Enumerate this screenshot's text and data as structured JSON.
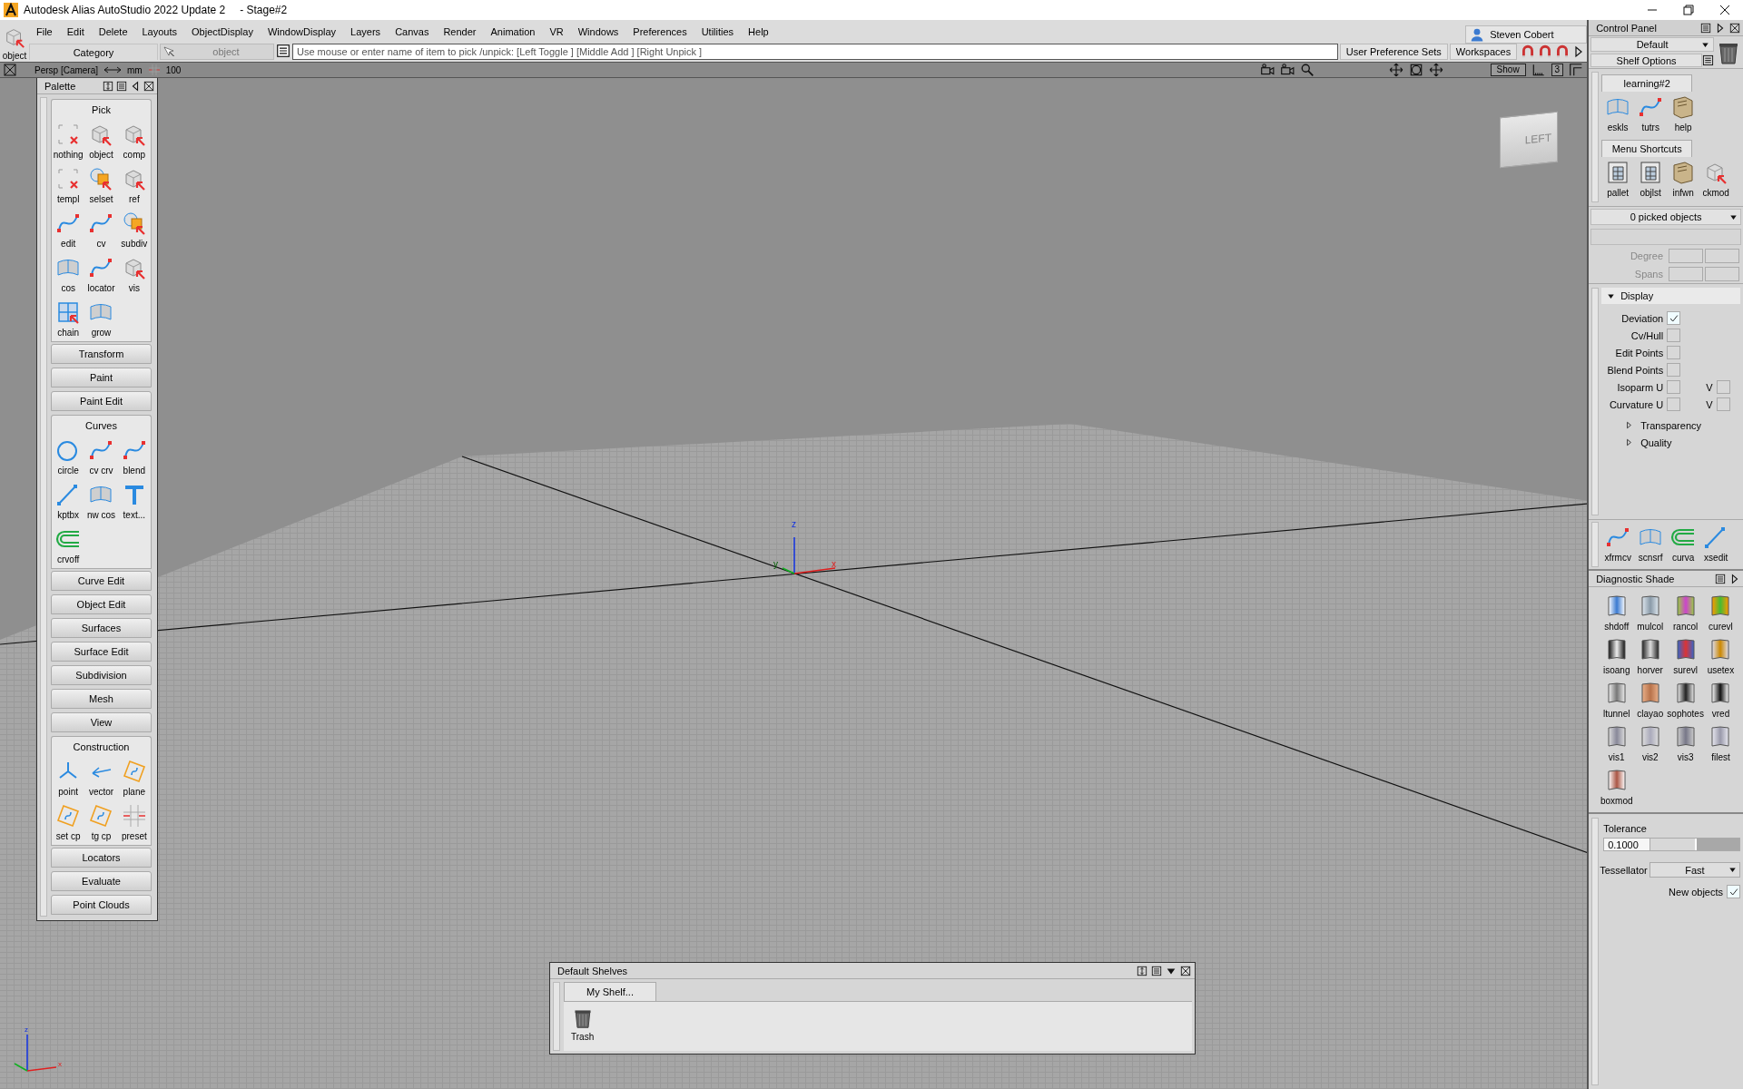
{
  "window": {
    "title": "Autodesk Alias AutoStudio 2022 Update 2",
    "document": "- Stage#2"
  },
  "pick_mode": {
    "label": "object"
  },
  "menu_bar": [
    "File",
    "Edit",
    "Delete",
    "Layouts",
    "ObjectDisplay",
    "WindowDisplay",
    "Layers",
    "Canvas",
    "Render",
    "Animation",
    "VR",
    "Windows",
    "Preferences",
    "Utilities",
    "Help"
  ],
  "user": {
    "name": "Steven Cobert"
  },
  "toolbar": {
    "category": "Category",
    "pick_field": "object",
    "prompt": "Use mouse or enter name of item to pick /unpick: [Left Toggle ] [Middle Add ] [Right Unpick ]",
    "buttons": [
      "User Preference Sets",
      "Workspaces"
    ]
  },
  "viewport": {
    "camera": "Persp [Camera]",
    "units": "mm",
    "grid": "100",
    "show_button": "Show",
    "layout_number": "3",
    "view_cube": "LEFT",
    "axis_labels": [
      "z",
      "y",
      "x"
    ],
    "corner_axis_labels": [
      "z",
      "x"
    ]
  },
  "palette": {
    "title": "Palette",
    "sections": [
      {
        "label": "Pick",
        "expanded": true,
        "tools": [
          "nothing",
          "object",
          "comp",
          "templ",
          "selset",
          "ref",
          "edit",
          "cv",
          "subdiv",
          "cos",
          "locator",
          "vis",
          "chain",
          "grow"
        ]
      },
      {
        "label": "Transform",
        "expanded": false
      },
      {
        "label": "Paint",
        "expanded": false
      },
      {
        "label": "Paint Edit",
        "expanded": false
      },
      {
        "label": "Curves",
        "expanded": true,
        "tools": [
          "circle",
          "cv crv",
          "blend",
          "kptbx",
          "nw cos",
          "text...",
          "crvoff"
        ]
      },
      {
        "label": "Curve Edit",
        "expanded": false
      },
      {
        "label": "Object Edit",
        "expanded": false
      },
      {
        "label": "Surfaces",
        "expanded": false
      },
      {
        "label": "Surface Edit",
        "expanded": false
      },
      {
        "label": "Subdivision",
        "expanded": false
      },
      {
        "label": "Mesh",
        "expanded": false
      },
      {
        "label": "View",
        "expanded": false
      },
      {
        "label": "Construction",
        "expanded": true,
        "tools": [
          "point",
          "vector",
          "plane",
          "set cp",
          "tg cp",
          "preset"
        ]
      },
      {
        "label": "Locators",
        "expanded": false
      },
      {
        "label": "Evaluate",
        "expanded": false
      },
      {
        "label": "Point Clouds",
        "expanded": false
      }
    ]
  },
  "shelves_window": {
    "title": "Default Shelves",
    "tabs": [
      {
        "label": "My Shelf...",
        "selected": true
      }
    ],
    "items": [
      "Trash"
    ]
  },
  "control_panel": {
    "title": "Control Panel",
    "preset": "Default",
    "shelf_options": "Shelf Options",
    "shelves": [
      {
        "label": "learning#2",
        "tools": [
          "eskls",
          "tutrs",
          "help"
        ]
      },
      {
        "label": "Menu Shortcuts",
        "tools": [
          "pallet",
          "objlst",
          "infwn",
          "ckmod"
        ]
      }
    ],
    "picked": "0 picked objects",
    "fields": [
      "Degree",
      "Spans"
    ],
    "display": {
      "label": "Display",
      "expanded": true,
      "options": [
        {
          "label": "Deviation",
          "checked": true
        },
        {
          "label": "Cv/Hull",
          "checked": false
        },
        {
          "label": "Edit Points",
          "checked": false
        },
        {
          "label": "Blend Points",
          "checked": false
        },
        {
          "label": "Isoparm U",
          "checked": false,
          "v_label": "V",
          "v_checked": false
        },
        {
          "label": "Curvature U",
          "checked": false,
          "v_label": "V",
          "v_checked": false
        }
      ],
      "subsections": [
        {
          "label": "Transparency",
          "expanded": false
        },
        {
          "label": "Quality",
          "expanded": false
        }
      ]
    },
    "bottom_tools": [
      "xfrmcv",
      "scnsrf",
      "curva",
      "xsedit"
    ]
  },
  "diagnostic_shade": {
    "title": "Diagnostic Shade",
    "tools": [
      "shdoff",
      "mulcol",
      "rancol",
      "curevl",
      "isoang",
      "horver",
      "surevl",
      "usetex",
      "ltunnel",
      "clayao",
      "sophotes",
      "vred",
      "vis1",
      "vis2",
      "vis3",
      "filest",
      "boxmod"
    ]
  },
  "tessellation": {
    "tolerance_label": "Tolerance",
    "tolerance": "0.1000",
    "level": 0.5,
    "tessellator_label": "Tessellator",
    "tessellator": "Fast",
    "new_objects_label": "New objects",
    "new_objects": true
  }
}
